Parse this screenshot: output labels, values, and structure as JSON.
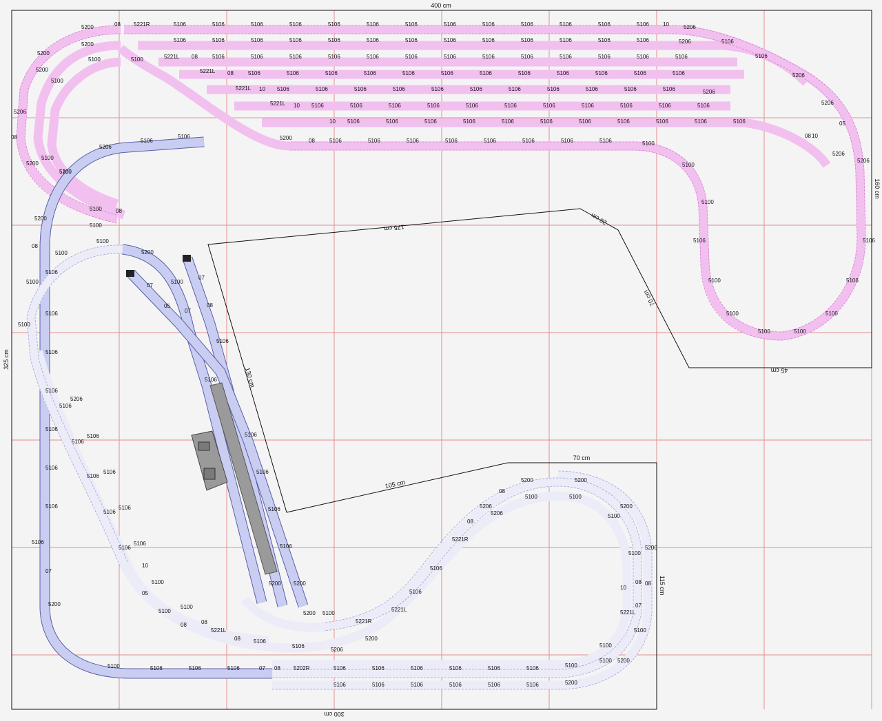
{
  "dimensions": {
    "top": "400 cm",
    "left": "325 cm",
    "right": "160 cm",
    "bottom": "300 cm",
    "segment_175": "175 cm",
    "segment_20": "20 cm",
    "segment_70a": "70 cm",
    "segment_105": "105 cm",
    "segment_70b": "70 cm",
    "segment_115": "115 cm",
    "segment_130": "130 cm",
    "segment_45": "45 cm"
  },
  "labels": {
    "part_5106": "5106",
    "part_5100": "5100",
    "part_5200": "5200",
    "part_5206": "5206",
    "part_5221R": "5221R",
    "part_5202R": "5202R",
    "part_5221L": "5221L",
    "part_10": "10",
    "part_08": "08",
    "part_07": "07",
    "part_05": "05"
  },
  "colors": {
    "pink_track": "#f2c0ef",
    "pink_stroke": "#d77ad2",
    "blue_track": "#c9cdf2",
    "blue_stroke": "#5a5fa6",
    "lavender_track": "#ecebf8",
    "lavender_stroke": "#9ea3d8",
    "grid": "#e48e8e",
    "platform": "#9a9a9a"
  }
}
